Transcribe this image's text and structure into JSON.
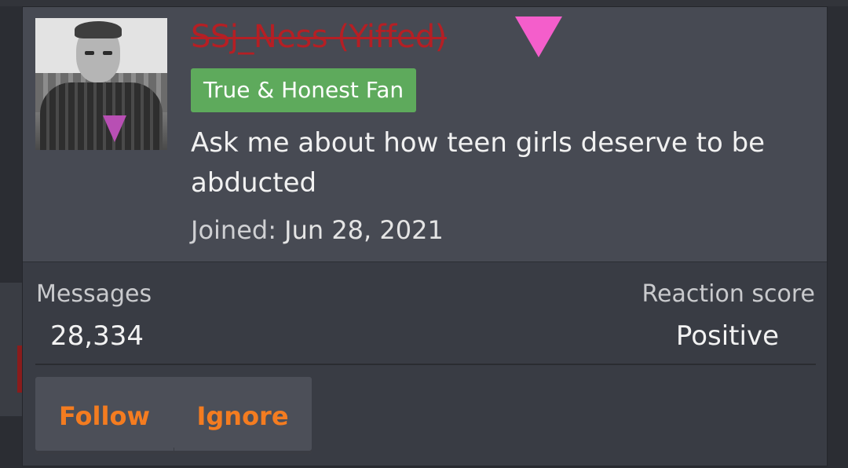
{
  "profile": {
    "username": "SSj_Ness (Yiffed)",
    "username_color": "#b51f24",
    "marker_icon": "pink-triangle-icon",
    "marker_color": "#f45ecb",
    "badge": "True & Honest Fan",
    "badge_color": "#5eaa5c",
    "status": "Ask me about how teen girls deserve to be abducted",
    "joined_label": "Joined:",
    "joined_date": "Jun 28, 2021"
  },
  "stats": {
    "messages_label": "Messages",
    "messages_value": "28,334",
    "reaction_label": "Reaction score",
    "reaction_value": "Positive"
  },
  "actions": {
    "follow": "Follow",
    "ignore": "Ignore",
    "accent_color": "#f47c20"
  }
}
